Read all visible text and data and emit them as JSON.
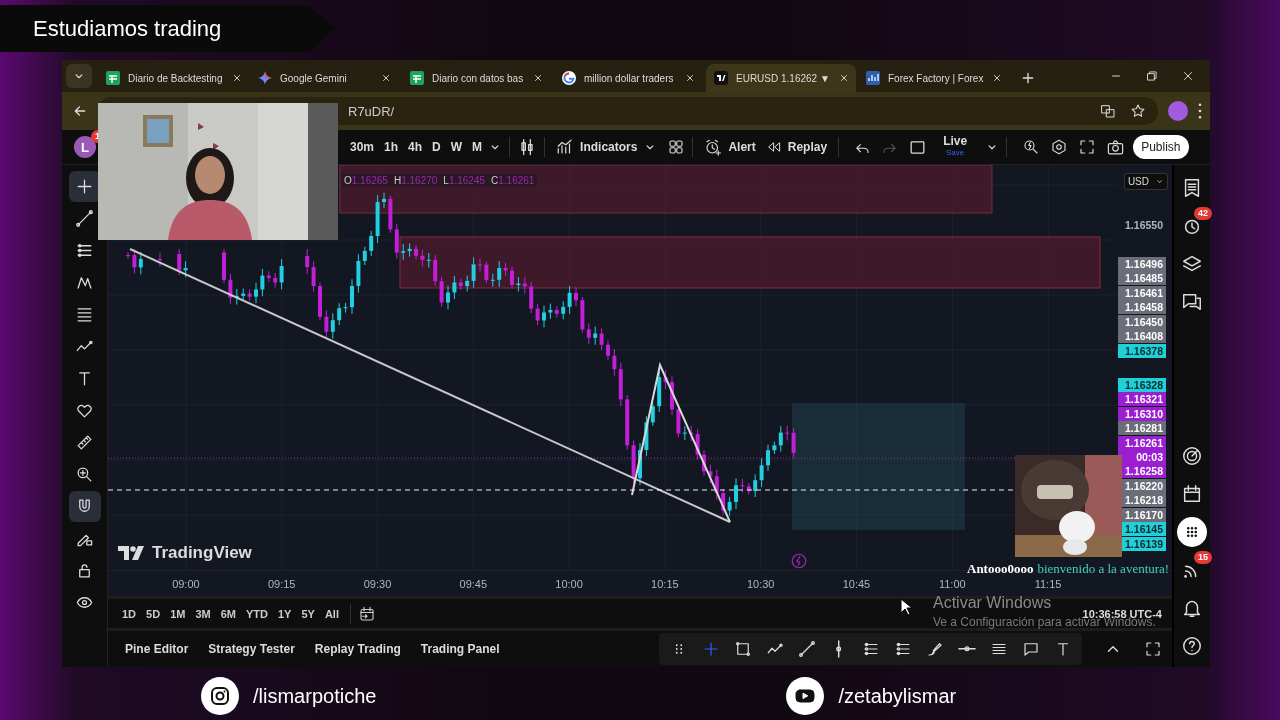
{
  "banner": {
    "title": "Estudiamos trading"
  },
  "browser": {
    "tabs": [
      {
        "title": "Diario de Backtesting",
        "kind": "sheet",
        "selected": false
      },
      {
        "title": "Google Gemini",
        "kind": "sparkle",
        "selected": false
      },
      {
        "title": "Diario con datos bas",
        "kind": "sheet",
        "selected": false
      },
      {
        "title": "million dollar traders",
        "kind": "ring",
        "selected": false
      },
      {
        "title": "EURUSD 1.16262 ▼",
        "kind": "logo",
        "selected": true
      },
      {
        "title": "Forex Factory | Forex",
        "kind": "chart",
        "selected": false
      }
    ],
    "url": "R7uDR/"
  },
  "toolbar": {
    "avatar": "L",
    "avatar_badge": "1",
    "intervals": [
      "30m",
      "1h",
      "4h",
      "D",
      "W",
      "M"
    ],
    "indicators": "Indicators",
    "alert": "Alert",
    "replay": "Replay",
    "redo_disabled": true,
    "live": "Live",
    "live_sub": "Save",
    "publish": "Publish"
  },
  "left_tools": [
    {
      "kind": "crosshair",
      "selected": true
    },
    {
      "kind": "trend-line",
      "selected": false
    },
    {
      "kind": "lines",
      "selected": false
    },
    {
      "kind": "pattern",
      "selected": false
    },
    {
      "kind": "fib",
      "selected": false
    },
    {
      "kind": "zigzag",
      "selected": false
    },
    {
      "kind": "text",
      "selected": false
    },
    {
      "kind": "heart",
      "selected": false
    },
    {
      "kind": "ruler",
      "selected": false
    },
    {
      "kind": "zoom",
      "selected": false
    },
    {
      "kind": "magnet",
      "selected": true
    },
    {
      "kind": "pencil-lock",
      "selected": false
    },
    {
      "kind": "lock",
      "selected": false
    },
    {
      "kind": "eye",
      "selected": false
    }
  ],
  "chart": {
    "legend": [
      {
        "key": "O",
        "value": "1.16265"
      },
      {
        "key": "H",
        "value": "1.16270"
      },
      {
        "key": "L",
        "value": "1.16245"
      },
      {
        "key": "C",
        "value": "1.16261"
      }
    ],
    "currency": "USD",
    "price_labels": [
      {
        "price": "1.16550"
      },
      {
        "price": "1.16496",
        "color": "#6b6e78"
      },
      {
        "price": "1.16485",
        "color": "#6b6e78"
      },
      {
        "price": "1.16461",
        "color": "#6b6e78"
      },
      {
        "price": "1.16458",
        "color": "#6b6e78"
      },
      {
        "price": "1.16450",
        "color": "#6b6e78"
      },
      {
        "price": "1.16408",
        "color": "#6b6e78"
      },
      {
        "price": "1.16378",
        "color": "#20d0d8"
      },
      {
        "price": "1.16328",
        "color": "#20d0d8"
      },
      {
        "price": "1.16321",
        "color": "#9a1fd0"
      },
      {
        "price": "1.16310",
        "color": "#9a1fd0"
      },
      {
        "price": "1.16281",
        "color": "#6b6e78"
      },
      {
        "price": "1.16261",
        "color": "#9a1fd0",
        "countdown": "00:03"
      },
      {
        "price": "1.16258",
        "color": "#9a1fd0"
      },
      {
        "price": "1.16220",
        "color": "#6b6e78"
      },
      {
        "price": "1.16218",
        "color": "#6b6e78"
      },
      {
        "price": "1.16170",
        "color": "#6b6e78"
      },
      {
        "price": "1.16145",
        "color": "#20d0d8"
      },
      {
        "price": "1.16139",
        "color": "#20d0d8"
      }
    ],
    "time_labels": [
      "09:00",
      "09:15",
      "09:30",
      "09:45",
      "10:00",
      "10:15",
      "10:30",
      "10:45",
      "11:00",
      "11:15"
    ],
    "logo": "TradingView"
  },
  "ranges": [
    "1D",
    "5D",
    "1M",
    "3M",
    "6M",
    "YTD",
    "1Y",
    "5Y",
    "All"
  ],
  "clock": "10:36:58 UTC-4",
  "bottom_tabs": [
    "Pine Editor",
    "Strategy Tester",
    "Replay Trading",
    "Trading Panel"
  ],
  "drawing_bar": [
    {
      "kind": "grip",
      "selected": false
    },
    {
      "kind": "crosshair",
      "selected": true
    },
    {
      "kind": "rectangle",
      "selected": false
    },
    {
      "kind": "zigzag",
      "selected": false
    },
    {
      "kind": "trend-line",
      "selected": false
    },
    {
      "kind": "vertical-line",
      "selected": false
    },
    {
      "kind": "lines",
      "selected": false
    },
    {
      "kind": "lines",
      "selected": false
    },
    {
      "kind": "brush",
      "selected": false
    },
    {
      "kind": "horizontal-line",
      "selected": false
    },
    {
      "kind": "menu",
      "selected": false
    },
    {
      "kind": "comment",
      "selected": false
    },
    {
      "kind": "text",
      "selected": false
    }
  ],
  "right_sidebar": [
    {
      "kind": "watchlist",
      "selected": false
    },
    {
      "kind": "alerts",
      "badge": "42",
      "selected": false
    },
    {
      "kind": "layers",
      "selected": false
    },
    {
      "kind": "chat",
      "selected": false
    },
    {
      "kind": "target",
      "selected": false
    },
    {
      "kind": "calendar",
      "selected": false
    },
    {
      "kind": "apps",
      "selected": true
    },
    {
      "kind": "signals",
      "badge": "15",
      "selected": false
    },
    {
      "kind": "bell",
      "selected": false
    },
    {
      "kind": "help",
      "selected": false
    }
  ],
  "stream_chat": {
    "user": "Antooo0ooo",
    "message": "bienvenido a la aventura!"
  },
  "windows_notice": {
    "title": "Activar Windows",
    "text": "Ve a Configuración para activar Windows."
  },
  "socials": [
    {
      "kind": "instagram",
      "handle": "/lismarpotiche"
    },
    {
      "kind": "youtube",
      "handle": "/zetabylismar"
    }
  ]
}
